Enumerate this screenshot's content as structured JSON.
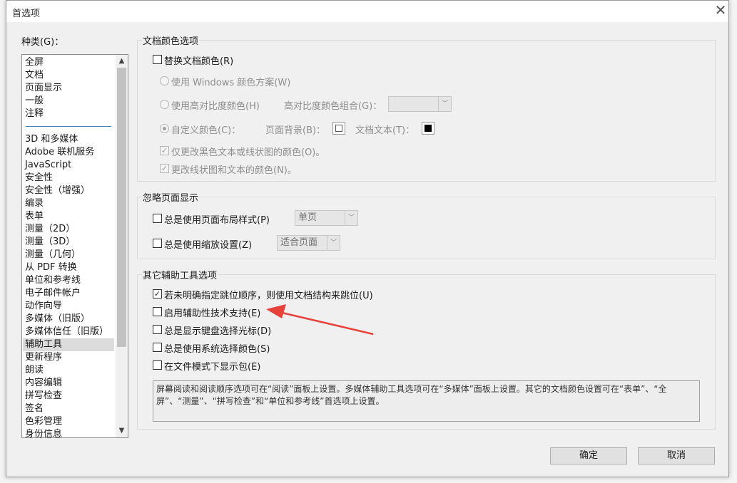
{
  "window": {
    "title": "首选项",
    "close_glyph": "✕"
  },
  "categories": {
    "label": "种类(G)：",
    "top_items": [
      "全屏",
      "文档",
      "页面显示",
      "一般",
      "注释"
    ],
    "items": [
      "3D 和多媒体",
      "Adobe 联机服务",
      "JavaScript",
      "安全性",
      "安全性（增强）",
      "编录",
      "表单",
      "测量（2D）",
      "测量（3D）",
      "测量（几何）",
      "从 PDF 转换",
      "单位和参考线",
      "电子邮件帐户",
      "动作向导",
      "多媒体（旧版）",
      "多媒体信任（旧版）",
      "辅助工具",
      "更新程序",
      "朗读",
      "内容编辑",
      "拼写检查",
      "签名",
      "色彩管理",
      "身份信息"
    ],
    "selected": "辅助工具"
  },
  "doc_colors": {
    "title": "文档颜色选项",
    "replace": "替换文档颜色(R)",
    "windows": "使用 Windows 颜色方案(W)",
    "high_contrast": "使用高对比度颜色(H)",
    "hc_combo_label": "高对比度颜色组合(G)：",
    "custom": "自定义颜色(C)：",
    "page_bg": "页面背景(B)：",
    "doc_text": "文档文本(T)：",
    "black_only": "仅更改黑色文本或线状图的颜色(O)。",
    "line_art": "更改线状图和文本的颜色(N)。"
  },
  "override": {
    "title": "忽略页面显示",
    "layout": "总是使用页面布局样式(P)",
    "layout_value": "单页",
    "zoom": "总是使用缩放设置(Z)",
    "zoom_value": "适合页面"
  },
  "other": {
    "title": "其它辅助工具选项",
    "reading_order": "若未明确指定跳位顺序，则使用文档结构来跳位(U)",
    "assistive": "启用辅助性技术支持(E)",
    "keyboard_cursor": "总是显示键盘选择光标(D)",
    "system_color": "总是使用系统选择颜色(S)",
    "portfolio": "在文件模式下显示包(E)",
    "info": "屏幕阅读和阅读顺序选项可在“阅读”面板上设置。多媒体辅助工具选项可在“多媒体”面板上设置。其它的文档颜色设置可在“表单”、“全屏”、“测量”、“拼写检查”和“单位和参考线”首选项上设置。"
  },
  "buttons": {
    "ok": "确定",
    "cancel": "取消"
  },
  "colors": {
    "arrow": "#e8413a",
    "accent": "#4a7fb0"
  }
}
